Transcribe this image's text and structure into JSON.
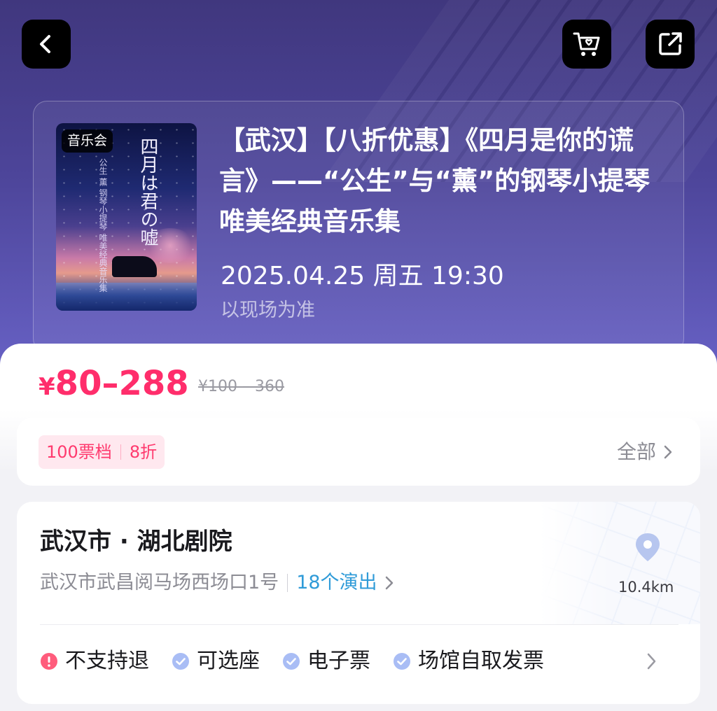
{
  "header": {
    "back_icon": "chevron-left-icon",
    "cart_icon": "cart-heart-icon",
    "share_icon": "share-external-icon"
  },
  "event": {
    "category_tag": "音乐会",
    "title": "【武汉】【八折优惠】《四月是你的谎言》——“公生”与“薰”的钢琴小提琴唯美经典音乐集",
    "datetime": "2025.04.25 周五 19:30",
    "date_note": "以现场为准",
    "poster": {
      "main_text": "四月は君の嘘",
      "sub_text": "公生 薰 钢琴小提琴 唯美经典音乐集"
    }
  },
  "pricing": {
    "currency": "¥",
    "range": "80–288",
    "original": "¥100 – 360",
    "accent_color": "#ff2d6b"
  },
  "tiers": {
    "count_label": "100票档",
    "discount_label": "8折",
    "all_label": "全部"
  },
  "venue": {
    "name": "武汉市 · 湖北剧院",
    "address": "武汉市武昌阅马场西场口1号",
    "shows_label": "18个演出",
    "distance": "10.4km"
  },
  "features": [
    {
      "label": "不支持退",
      "icon": "exclamation-circle-icon",
      "color": "#ff5c7c"
    },
    {
      "label": "可选座",
      "icon": "check-circle-icon",
      "color": "#a9bdf5"
    },
    {
      "label": "电子票",
      "icon": "check-circle-icon",
      "color": "#a9bdf5"
    },
    {
      "label": "场馆自取发票",
      "icon": "check-circle-icon",
      "color": "#a9bdf5"
    }
  ]
}
